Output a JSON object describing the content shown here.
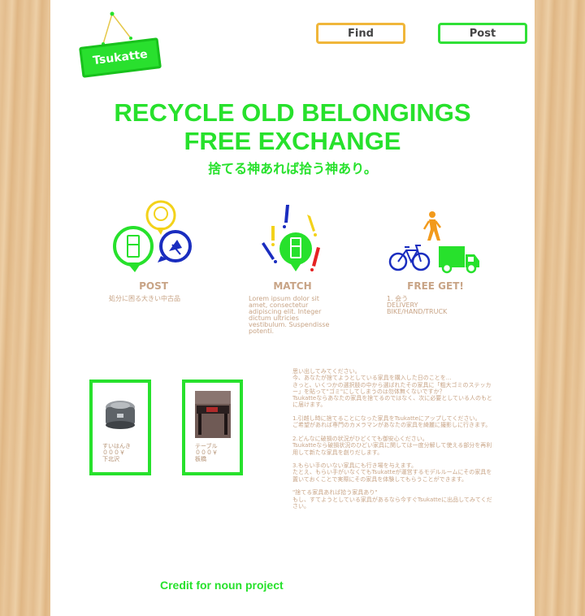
{
  "header": {
    "logo_text": "Tsukatte",
    "find_label": "Find",
    "post_label": "Post"
  },
  "hero": {
    "title_line1": "RECYCLE OLD BELONGINGS",
    "title_line2": "FREE EXCHANGE",
    "subtitle": "捨てる神あれば拾う神あり。"
  },
  "steps": [
    {
      "title": "POST",
      "desc": "処分に困る大きい中古品"
    },
    {
      "title": "MATCH",
      "desc": "Lorem ipsum dolor sit amet, consectetur adipiscing elit. Integer dictum ultricies vestibulum. Suspendisse potenti."
    },
    {
      "title": "FREE GET!",
      "desc_line1": "1. 会う",
      "desc_line2": "DELIVERY",
      "desc_line3": "BIKE/HAND/TRUCK"
    }
  ],
  "items": [
    {
      "name": "すいはんき",
      "price": "０００￥",
      "location": "下北沢"
    },
    {
      "name": "テーブル",
      "price": "０００￥",
      "location": "板橋"
    }
  ],
  "story": [
    "思い出してみてください。\n今、あなたが捨てようとしている家具を購入した日のことを...\nきっと、いくつかの選択肢の中から選ばれたその家具に「粗大ゴミのステッカー」を貼って\"ゴミ\"にしてしまうのは勿体無くないですか？\nTsukatteならあなたの家具を捨てるのではなく、次に必要としている人のもとに届けます。",
    "1.引越し時に捨てることになった家具をTsukatteにアップしてください。\nご希望があれば専門のカメラマンがあなたの家具を綺麗に撮影しに行きます。",
    "2.どんなに破損の状況がひどくても御安心ください。\nTsukatteなら破損状況のひどい家具に関しては一度分解して使える部分を再利用して新たな家具を創りだします。",
    "3.もらい手のいない家具にも行き場を与えます。\nたとえ、もらい手がいなくてもTsukatteが運営するモデルルームにその家具を置いておくことで実際にその家具を体験してもらうことができます。",
    "\"捨てる家具あれば拾う家具あり\"\nもし、すてようとしている家具があるなら今すぐTsukatteに出品してみてください。"
  ],
  "footer": {
    "credit": "Credit for noun project"
  },
  "colors": {
    "accent_green": "#27e12c",
    "find_border": "#f0b63a",
    "text_tan": "#c8a486",
    "match_icon_blue": "#1a2dbf",
    "match_icon_red": "#e52222",
    "match_icon_yellow": "#f3d21a",
    "walker_orange": "#f29a1c"
  }
}
